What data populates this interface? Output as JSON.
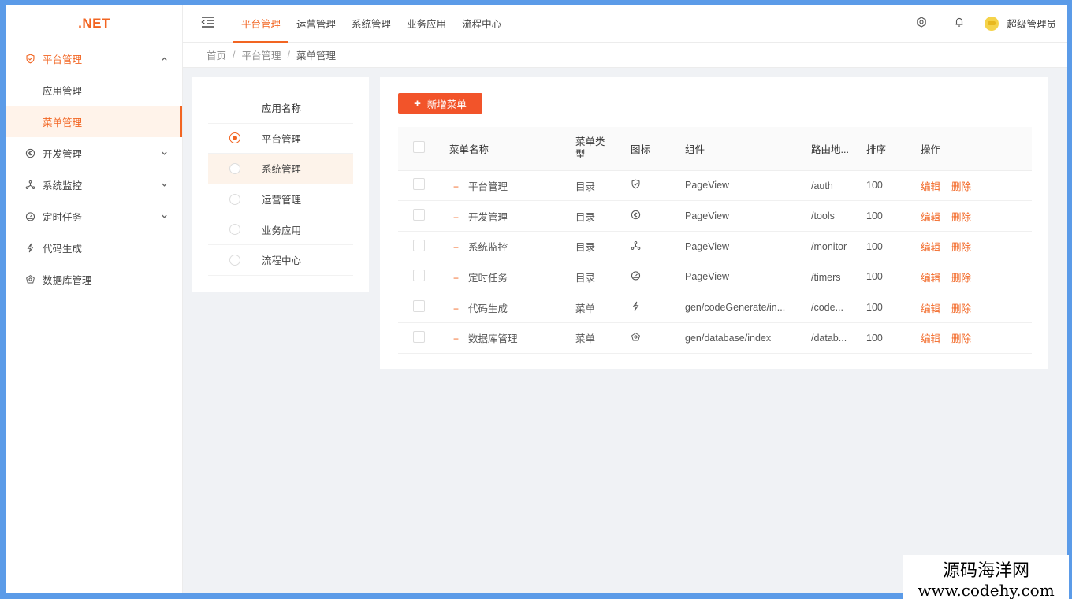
{
  "logo": ".NET",
  "sidebar": {
    "items": [
      {
        "label": "平台管理",
        "icon": "shield-icon",
        "expanded": true
      },
      {
        "label": "应用管理",
        "sub": true
      },
      {
        "label": "菜单管理",
        "sub": true,
        "selected": true
      },
      {
        "label": "开发管理",
        "icon": "euro-circle-icon"
      },
      {
        "label": "系统监控",
        "icon": "network-icon"
      },
      {
        "label": "定时任务",
        "icon": "gauge-icon"
      },
      {
        "label": "代码生成",
        "icon": "bolt-icon"
      },
      {
        "label": "数据库管理",
        "icon": "database-icon"
      }
    ]
  },
  "topnav": {
    "tabs": [
      {
        "label": "平台管理",
        "active": true
      },
      {
        "label": "运营管理"
      },
      {
        "label": "系统管理"
      },
      {
        "label": "业务应用"
      },
      {
        "label": "流程中心"
      }
    ],
    "user": "超级管理员"
  },
  "breadcrumb": {
    "home": "首页",
    "parent": "平台管理",
    "current": "菜单管理",
    "sep": "/"
  },
  "apps": {
    "header": "应用名称",
    "rows": [
      {
        "label": "平台管理",
        "checked": true
      },
      {
        "label": "系统管理",
        "hover": true
      },
      {
        "label": "运营管理"
      },
      {
        "label": "业务应用"
      },
      {
        "label": "流程中心"
      }
    ]
  },
  "menus": {
    "add_label": "新增菜单",
    "columns": {
      "name": "菜单名称",
      "type": "菜单类型",
      "icon": "图标",
      "component": "组件",
      "route": "路由地...",
      "sort": "排序",
      "ops": "操作"
    },
    "rows": [
      {
        "name": "平台管理",
        "type": "目录",
        "icon": "shield-icon",
        "component": "PageView",
        "route": "/auth",
        "sort": "100"
      },
      {
        "name": "开发管理",
        "type": "目录",
        "icon": "euro-circle-icon",
        "component": "PageView",
        "route": "/tools",
        "sort": "100"
      },
      {
        "name": "系统监控",
        "type": "目录",
        "icon": "network-icon",
        "component": "PageView",
        "route": "/monitor",
        "sort": "100"
      },
      {
        "name": "定时任务",
        "type": "目录",
        "icon": "gauge-icon",
        "component": "PageView",
        "route": "/timers",
        "sort": "100"
      },
      {
        "name": "代码生成",
        "type": "菜单",
        "icon": "bolt-icon",
        "component": "gen/codeGenerate/in...",
        "route": "/code...",
        "sort": "100"
      },
      {
        "name": "数据库管理",
        "type": "菜单",
        "icon": "database-icon",
        "component": "gen/database/index",
        "route": "/datab...",
        "sort": "100"
      }
    ],
    "edit": "编辑",
    "delete": "删除"
  },
  "watermark": {
    "line1": "源码海洋网",
    "line2": "www.codehy.com"
  },
  "colors": {
    "accent": "#f26522",
    "button": "#f2542a"
  }
}
